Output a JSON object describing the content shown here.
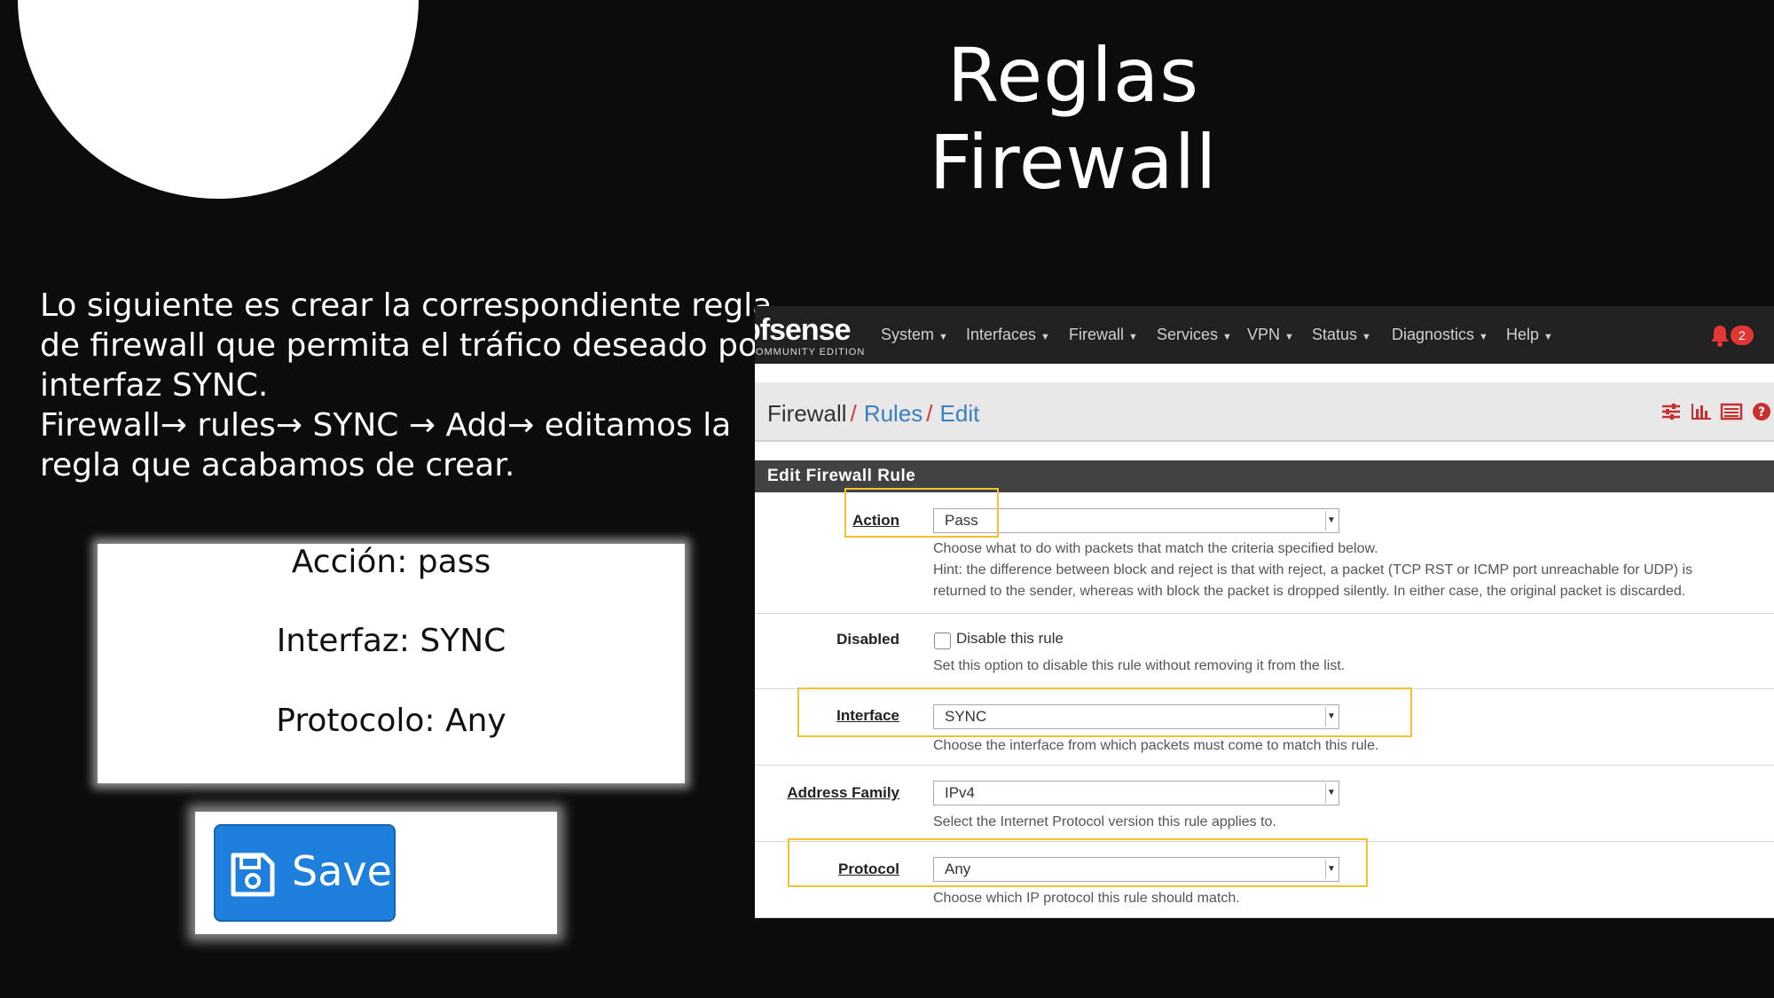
{
  "slide": {
    "title": "Reglas Firewall",
    "body_lines": [
      "Lo siguiente es crear la correspondiente regla",
      "de firewall que permita el tráfico deseado por la",
      "interfaz SYNC.",
      "Firewall→ rules→ SYNC → Add→ editamos la",
      "regla que acabamos de crear."
    ],
    "card_lines": [
      "Acción: pass",
      "Interfaz: SYNC",
      "Protocolo: Any"
    ],
    "save_button": {
      "label": "Save",
      "icon": "floppy-disk-icon",
      "color": "#1f7fdc"
    }
  },
  "pfsense": {
    "logo": "pfsense",
    "logo_sub": "COMMUNITY EDITION",
    "nav": [
      "System",
      "Interfaces",
      "Firewall",
      "Services",
      "VPN",
      "Status",
      "Diagnostics",
      "Help"
    ],
    "notification_count": "2",
    "breadcrumb": {
      "root": "Firewall",
      "sep": "/",
      "level2": "Rules",
      "level3": "Edit"
    },
    "toolbar_icons": [
      "sliders-icon",
      "bar-chart-icon",
      "list-table-icon",
      "help-circle-icon"
    ],
    "panel_title": "Edit Firewall Rule",
    "fields": {
      "action": {
        "label": "Action",
        "value": "Pass",
        "help": [
          "Choose what to do with packets that match the criteria specified below.",
          "Hint: the difference between block and reject is that with reject, a packet (TCP RST or ICMP port unreachable for UDP) is",
          "returned to the sender, whereas with block the packet is dropped silently. In either case, the original packet is discarded."
        ]
      },
      "disabled": {
        "label": "Disabled",
        "checkbox_label": "Disable this rule",
        "checked": false,
        "help": "Set this option to disable this rule without removing it from the list."
      },
      "interface": {
        "label": "Interface",
        "value": "SYNC",
        "help": "Choose the interface from which packets must come to match this rule."
      },
      "address_family": {
        "label": "Address Family",
        "value": "IPv4",
        "help": "Select the Internet Protocol version this rule applies to."
      },
      "protocol": {
        "label": "Protocol",
        "value": "Any",
        "help": "Choose which IP protocol this rule should match."
      }
    },
    "colors": {
      "navbar": "#212121",
      "link": "#3a7fc4",
      "separator": "#cf3b3b",
      "highlight": "#f2c230",
      "panel_head": "#424242"
    }
  }
}
